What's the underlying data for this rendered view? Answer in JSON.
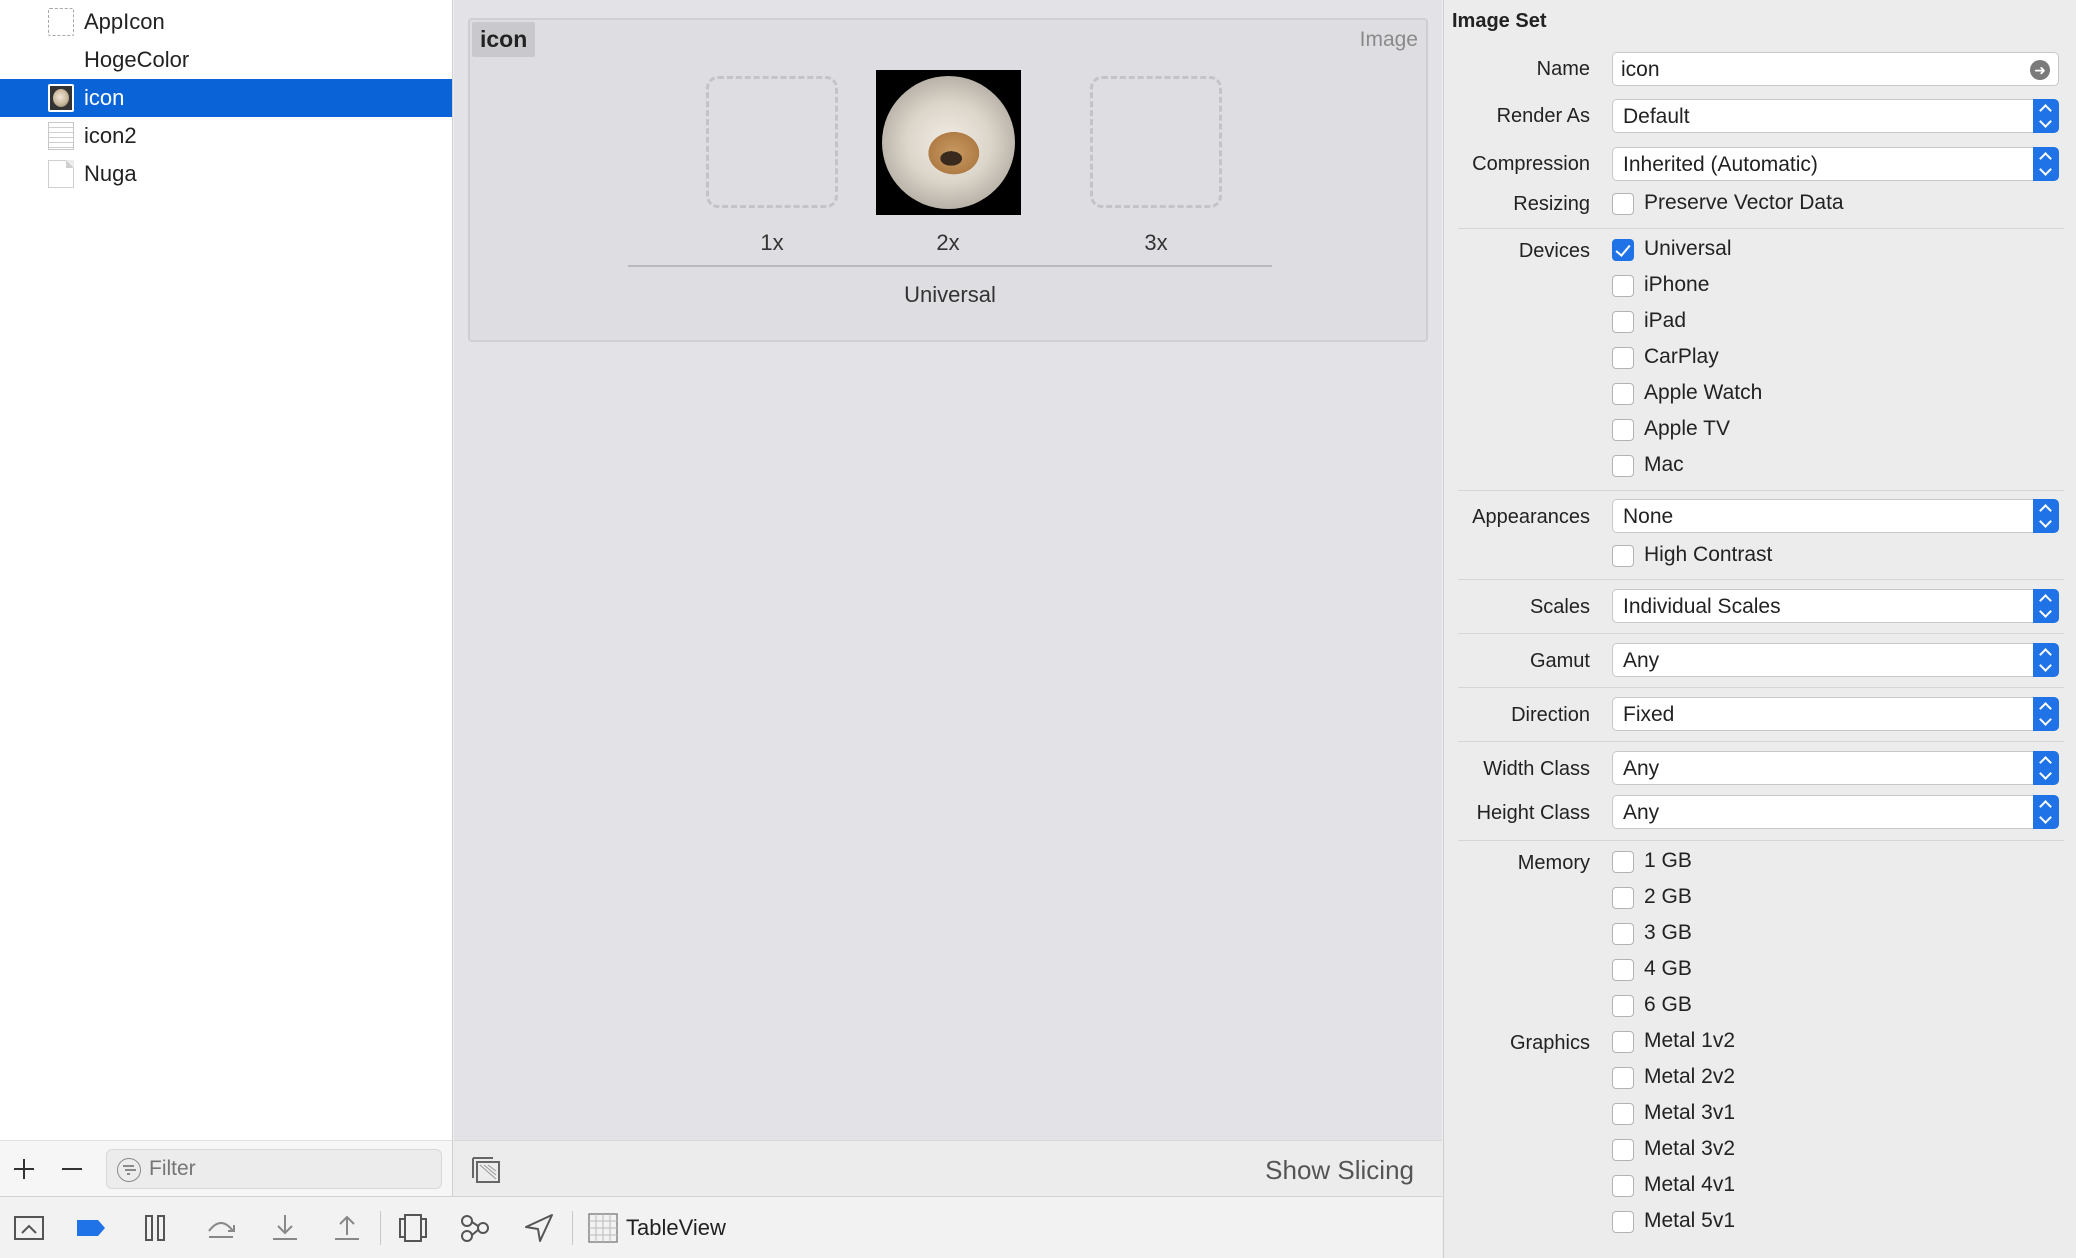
{
  "sidebar": {
    "assets": [
      {
        "label": "AppIcon",
        "thumb": "dashed"
      },
      {
        "label": "HogeColor",
        "thumb": "blank"
      },
      {
        "label": "icon",
        "thumb": "image",
        "selected": true
      },
      {
        "label": "icon2",
        "thumb": "list"
      },
      {
        "label": "Nuga",
        "thumb": "page"
      }
    ],
    "filter_placeholder": "Filter",
    "add_icon": "plus-icon",
    "remove_icon": "minus-icon"
  },
  "editor": {
    "card_title": "icon",
    "card_type": "Image",
    "scales": [
      "1x",
      "2x",
      "3x"
    ],
    "device_label": "Universal",
    "show_slicing": "Show Slicing"
  },
  "toolbar": {
    "scheme": "TableView",
    "icons": [
      "hide-debug-area-icon",
      "breakpoints-icon",
      "pause-icon",
      "step-over-icon",
      "step-into-icon",
      "step-out-icon",
      "view-hierarchy-icon",
      "memory-graph-icon",
      "simulate-location-icon",
      "scheme-grid-icon"
    ]
  },
  "inspector": {
    "title": "Image Set",
    "name_label": "Name",
    "name_value": "icon",
    "render_as_label": "Render As",
    "render_as_value": "Default",
    "compression_label": "Compression",
    "compression_value": "Inherited (Automatic)",
    "resizing_label": "Resizing",
    "preserve_vector": "Preserve Vector Data",
    "devices_label": "Devices",
    "devices": [
      {
        "label": "Universal",
        "checked": true
      },
      {
        "label": "iPhone",
        "checked": false
      },
      {
        "label": "iPad",
        "checked": false
      },
      {
        "label": "CarPlay",
        "checked": false
      },
      {
        "label": "Apple Watch",
        "checked": false
      },
      {
        "label": "Apple TV",
        "checked": false
      },
      {
        "label": "Mac",
        "checked": false
      }
    ],
    "appearances_label": "Appearances",
    "appearances_value": "None",
    "high_contrast": "High Contrast",
    "scales_label": "Scales",
    "scales_value": "Individual Scales",
    "gamut_label": "Gamut",
    "gamut_value": "Any",
    "direction_label": "Direction",
    "direction_value": "Fixed",
    "width_class_label": "Width Class",
    "width_class_value": "Any",
    "height_class_label": "Height Class",
    "height_class_value": "Any",
    "memory_label": "Memory",
    "memory": [
      "1 GB",
      "2 GB",
      "3 GB",
      "4 GB",
      "6 GB"
    ],
    "graphics_label": "Graphics",
    "graphics": [
      "Metal 1v2",
      "Metal 2v2",
      "Metal 3v1",
      "Metal 3v2",
      "Metal 4v1",
      "Metal 5v1"
    ]
  },
  "colors": {
    "selection": "#0a64d8",
    "accent": "#1f73e6"
  }
}
